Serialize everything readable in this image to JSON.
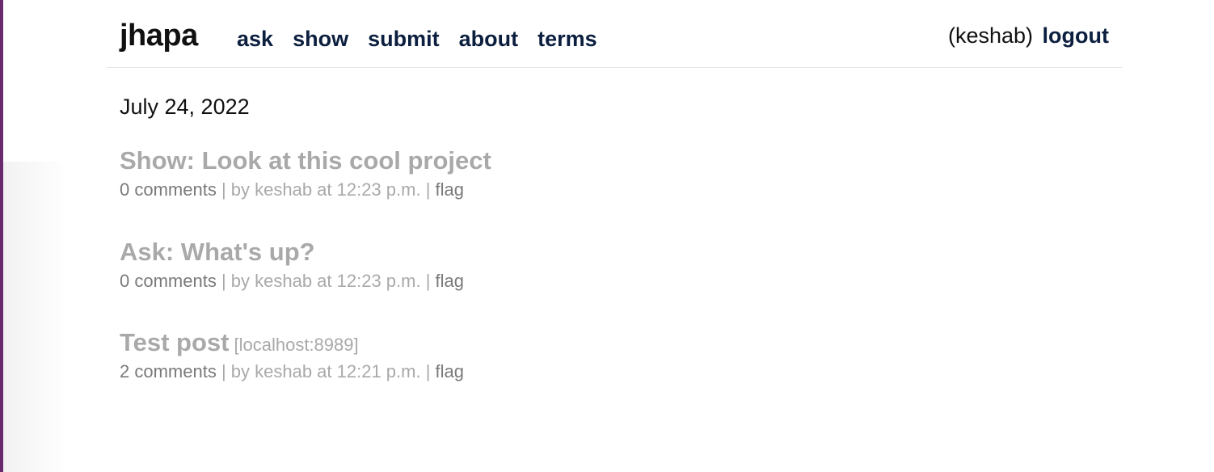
{
  "header": {
    "logo": "jhapa",
    "nav": [
      "ask",
      "show",
      "submit",
      "about",
      "terms"
    ],
    "user": "(keshab)",
    "logout": "logout"
  },
  "date": "July 24, 2022",
  "posts": [
    {
      "title": "Show: Look at this cool project",
      "domain": "",
      "comments": "0 comments",
      "byline": " | by keshab at 12:23 p.m. | ",
      "flag": "flag"
    },
    {
      "title": "Ask: What's up?",
      "domain": "",
      "comments": "0 comments",
      "byline": " | by keshab at 12:23 p.m. | ",
      "flag": "flag"
    },
    {
      "title": "Test post",
      "domain": "[localhost:8989]",
      "comments": "2 comments",
      "byline": " | by keshab at 12:21 p.m. | ",
      "flag": "flag"
    }
  ],
  "colors": {
    "nav": "#0c1f3f",
    "visited_title": "#a9a9a9",
    "meta_link": "#7a7a7a",
    "left_edge": "#6b2a6e"
  }
}
